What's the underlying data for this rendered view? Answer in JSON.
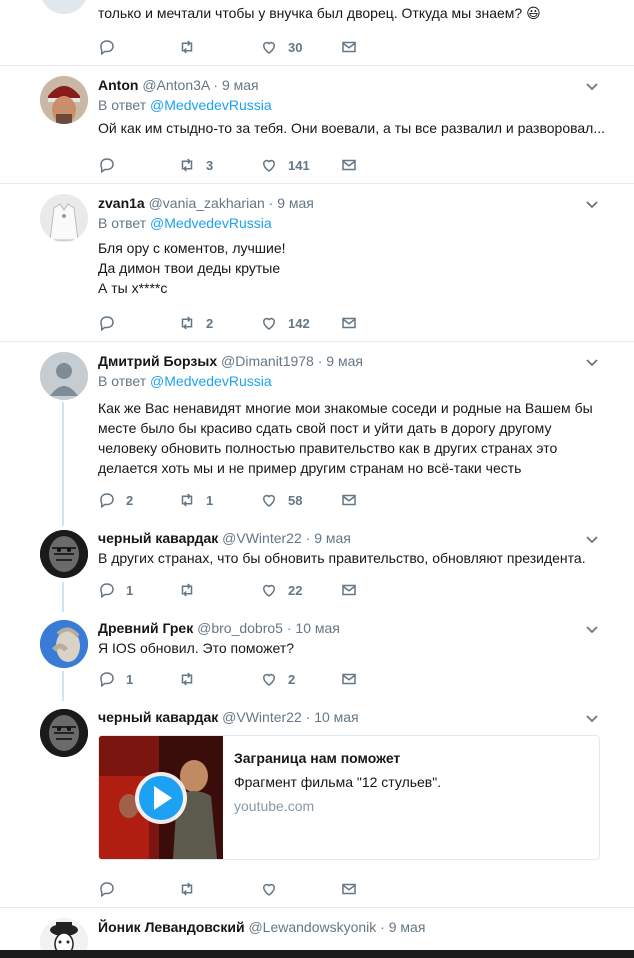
{
  "reply_prefix": "В ответ",
  "tweets": [
    {
      "text_lines": [
        "только и мечтали чтобы у внучка был дворец. Откуда мы знаем? 😃"
      ],
      "replies": "",
      "retweets": "",
      "likes": "30"
    },
    {
      "name": "Anton",
      "handle": "@Anton3A",
      "date": "9 мая",
      "mention": "@MedvedevRussia",
      "text_lines": [
        "Ой как им стыдно-то за тебя. Они воевали, а ты все развалил и разворовал..."
      ],
      "replies": "",
      "retweets": "3",
      "likes": "141"
    },
    {
      "name": "zvan1a",
      "handle": "@vania_zakharian",
      "date": "9 мая",
      "mention": "@MedvedevRussia",
      "text_lines": [
        "Бля ору с коментов, лучшие!",
        "Да димон твои деды крутые",
        "А ты х****с"
      ],
      "replies": "",
      "retweets": "2",
      "likes": "142"
    },
    {
      "name": "Дмитрий Борзых",
      "handle": "@Dimanit1978",
      "date": "9 мая",
      "mention": "@MedvedevRussia",
      "text_lines": [
        "Как же Вас ненавидят многие мои знакомые соседи и родные на Вашем бы",
        "месте было бы красиво сдать свой пост и уйти дать в дорогу другому",
        "человеку обновить полностью правительство как в других странах это",
        "делается хоть мы и не пример другим странам но всё-таки честь"
      ],
      "replies": "2",
      "retweets": "1",
      "likes": "58"
    },
    {
      "name": "черный кавардак",
      "handle": "@VWinter22",
      "date": "9 мая",
      "text_lines": [
        "В других странах, что бы обновить правительство, обновляют президента."
      ],
      "replies": "1",
      "retweets": "",
      "likes": "22"
    },
    {
      "name": "Древний Грек",
      "handle": "@bro_dobro5",
      "date": "10 мая",
      "text_lines": [
        "Я IOS обновил. Это поможет?"
      ],
      "replies": "1",
      "retweets": "",
      "likes": "2"
    },
    {
      "name": "черный кавардак",
      "handle": "@VWinter22",
      "date": "10 мая",
      "card": {
        "title": "Заграница нам поможет",
        "description": "Фрагмент фильма \"12 стульев\".",
        "domain": "youtube.com"
      },
      "replies": "",
      "retweets": "",
      "likes": ""
    },
    {
      "name": "Йоник Левандовский",
      "handle": "@Lewandowskyonik",
      "date": "9 мая"
    }
  ],
  "colors": {
    "accent": "#1da1f2",
    "muted": "#657786",
    "thread": "#cce4f5"
  }
}
